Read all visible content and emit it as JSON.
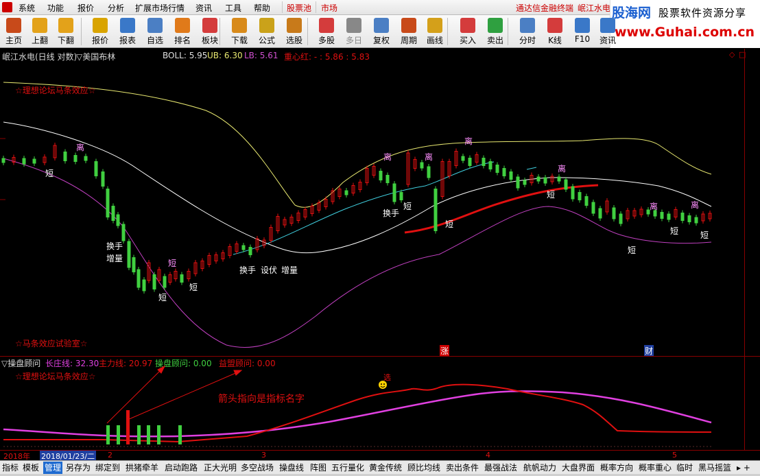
{
  "menu": {
    "items": [
      "系统",
      "功能",
      "报价",
      "分析",
      "扩展市场行情",
      "资讯",
      "工具",
      "帮助"
    ],
    "highlight_items": [
      "股票池",
      "市场"
    ],
    "title_right": "通达信金融终端",
    "stock_right": "岷江水电"
  },
  "banner": {
    "logo": "股海网",
    "slogan": "股票软件资源分享",
    "url": "www.Guhai.com.cn"
  },
  "toolbar": [
    {
      "label": "主页",
      "icon": "home-icon",
      "color": "#c84a1a"
    },
    {
      "label": "上翻",
      "icon": "arrow-up-icon",
      "color": "#e3a21a"
    },
    {
      "label": "下翻",
      "icon": "arrow-down-icon",
      "color": "#e3a21a"
    },
    {
      "label": "报价",
      "icon": "quote-icon",
      "color": "#d9a400"
    },
    {
      "label": "报表",
      "icon": "report-icon",
      "color": "#3a78c8"
    },
    {
      "label": "自选",
      "icon": "f6-icon",
      "color": "#4b7fc4"
    },
    {
      "label": "排名",
      "icon": "rank-icon",
      "color": "#e07a1a"
    },
    {
      "label": "板块",
      "icon": "sector-icon",
      "color": "#d43c3c"
    },
    {
      "label": "下载",
      "icon": "download-icon",
      "color": "#d88a1a"
    },
    {
      "label": "公式",
      "icon": "formula-icon",
      "color": "#caa21a"
    },
    {
      "label": "选股",
      "icon": "stock-select-icon",
      "color": "#c87a1a"
    },
    {
      "label": "多股",
      "icon": "multi-stock-icon",
      "color": "#d43c3c"
    },
    {
      "label": "多日",
      "icon": "multi-day-icon",
      "color": "#888888",
      "dim": true
    },
    {
      "label": "复权",
      "icon": "restore-right-icon",
      "color": "#4b7fc4"
    },
    {
      "label": "周期",
      "icon": "f8-icon",
      "color": "#c84a1a"
    },
    {
      "label": "画线",
      "icon": "draw-line-icon",
      "color": "#d4a01a"
    },
    {
      "label": "买入",
      "icon": "buy-icon",
      "color": "#d43c3c"
    },
    {
      "label": "卖出",
      "icon": "sell-icon",
      "color": "#2fa040"
    },
    {
      "label": "分时",
      "icon": "intraday-icon",
      "color": "#4b7fc4"
    },
    {
      "label": "K线",
      "icon": "kline-icon",
      "color": "#d43c3c"
    },
    {
      "label": "F10",
      "icon": "f10-icon",
      "color": "#3a78c8"
    },
    {
      "label": "资讯",
      "icon": "news-icon",
      "color": "#3a78c8"
    }
  ],
  "main_chart": {
    "title": "岷江水电(日线 对数)",
    "indicator_name": "▽美国布林",
    "boll_label": "BOLL: 5.95",
    "ub_label": "UB: 6.30",
    "lb_label": "LB: 5.61",
    "zhongxin_label": "重心红: - : 5.86 : 5.83",
    "watermark_top": "☆理想论坛马条效应☆",
    "watermark_bottom": "☆马条效应试验室☆",
    "annotations": [
      "离",
      "短",
      "离",
      "离",
      "离",
      "离",
      "离",
      "离",
      "短",
      "短",
      "短",
      "短",
      "短",
      "短",
      "短",
      "换手",
      "增量",
      "换手",
      "设伏",
      "增量",
      "换手"
    ],
    "markers": [
      "涨",
      "财"
    ],
    "colors": {
      "upper": "#e8e870",
      "mid": "#ffffff",
      "lower": "#c040c0",
      "red_line": "#e01010",
      "cyan": "#40d0e0"
    }
  },
  "sub_chart": {
    "name": "▽操盘顾问",
    "changzhuang": "长庄线: 32.30",
    "zhuli": "主力线: 20.97",
    "caopan": "操盘顾问: 0.00",
    "yiying": "益盟顾问: 0.00",
    "watermark": "☆理想论坛马条效应☆",
    "note": "箭头指向是指标名字",
    "select_label": "选",
    "colors": {
      "changzhuang": "#e040e0",
      "zhuli": "#e01010",
      "caopan": "#40d040",
      "yiying": "#e01010"
    }
  },
  "datebar": {
    "year": "2018年",
    "date": "2018/01/23/二",
    "months": [
      "2",
      "3",
      "4",
      "5"
    ]
  },
  "tabs": [
    "指标",
    "模板",
    "管理",
    "另存为",
    "绑定到",
    "拱猪牵羊",
    "启动跑路",
    "正大光明",
    "多空战场",
    "操盘线",
    "阵图",
    "五行量化",
    "黄金传统",
    "顾比均线",
    "卖出条件",
    "最强战法",
    "航帆动力",
    "大盘界面",
    "概率方向",
    "概率重心",
    "临时",
    "黑马摇篮"
  ],
  "active_tab": "管理"
}
